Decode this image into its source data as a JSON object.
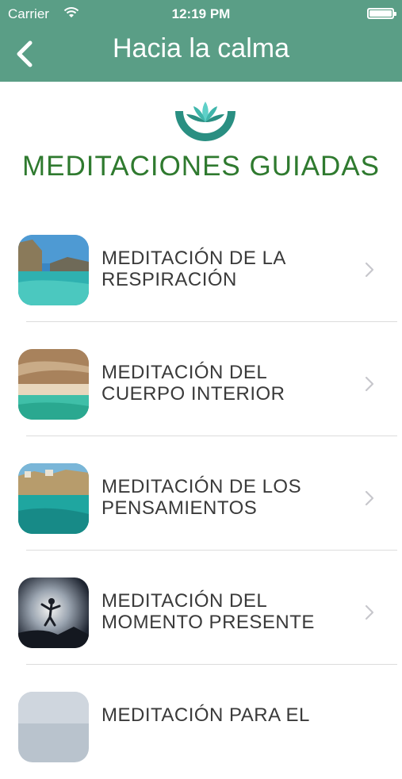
{
  "status_bar": {
    "carrier": "Carrier",
    "time": "12:19 PM"
  },
  "nav": {
    "title": "Hacia la calma",
    "back_icon": "chevron-left-icon"
  },
  "section": {
    "heading": "MEDITACIONES GUIADAS"
  },
  "colors": {
    "bar": "#5a9e86",
    "heading": "#2f7a2f",
    "logo_teal": "#2a8f82",
    "logo_light": "#5fd0c8"
  },
  "items": [
    {
      "line1": "MEDITACIÓN DE LA",
      "line2": "RESPIRACIÓN"
    },
    {
      "line1": "MEDITACIÓN DEL",
      "line2": "CUERPO INTERIOR"
    },
    {
      "line1": "MEDITACIÓN DE LOS",
      "line2": "PENSAMIENTOS"
    },
    {
      "line1": "MEDITACIÓN DEL",
      "line2": "MOMENTO PRESENTE"
    },
    {
      "line1": "MEDITACIÓN PARA EL",
      "line2": ""
    }
  ]
}
